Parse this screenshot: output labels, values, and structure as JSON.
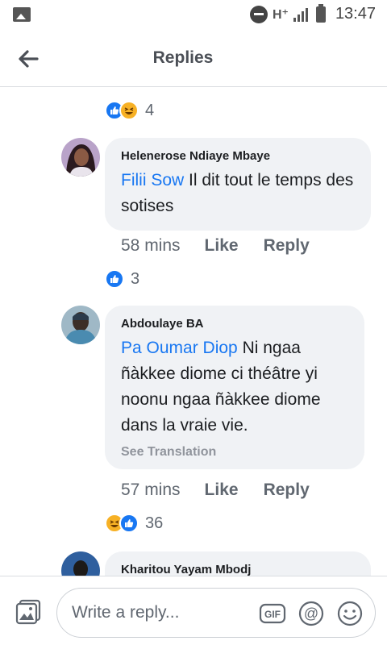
{
  "status": {
    "network": "H⁺",
    "time": "13:47"
  },
  "header": {
    "title": "Replies"
  },
  "top_reactions": {
    "count": "4"
  },
  "comments": [
    {
      "author": "Helenerose Ndiaye Mbaye",
      "mention": "Filii Sow",
      "text": " Il dit tout le temps des sotises",
      "time": "58 mins",
      "like": "Like",
      "reply": "Reply",
      "reaction_count": "3"
    },
    {
      "author": "Abdoulaye BA",
      "mention": "Pa Oumar Diop",
      "text": " Ni ngaa ñàkkee diome ci théâtre yi noonu ngaa ñàkkee diome dans la vraie vie.",
      "see_translation": "See Translation",
      "time": "57 mins",
      "like": "Like",
      "reply": "Reply",
      "reaction_count": "36"
    },
    {
      "author": "Kharitou Yayam Mbodj"
    }
  ],
  "composer": {
    "placeholder": "Write a reply..."
  },
  "colors": {
    "brand_blue": "#1877f2",
    "haha_yellow": "#f7b125",
    "bubble_bg": "#f0f2f5"
  },
  "icons": [
    "image-icon",
    "do-not-disturb-icon",
    "signal-icon",
    "battery-icon",
    "back-arrow-icon",
    "like-reaction-icon",
    "haha-reaction-icon",
    "photo-icon",
    "gif-icon",
    "at-icon",
    "emoji-icon"
  ]
}
